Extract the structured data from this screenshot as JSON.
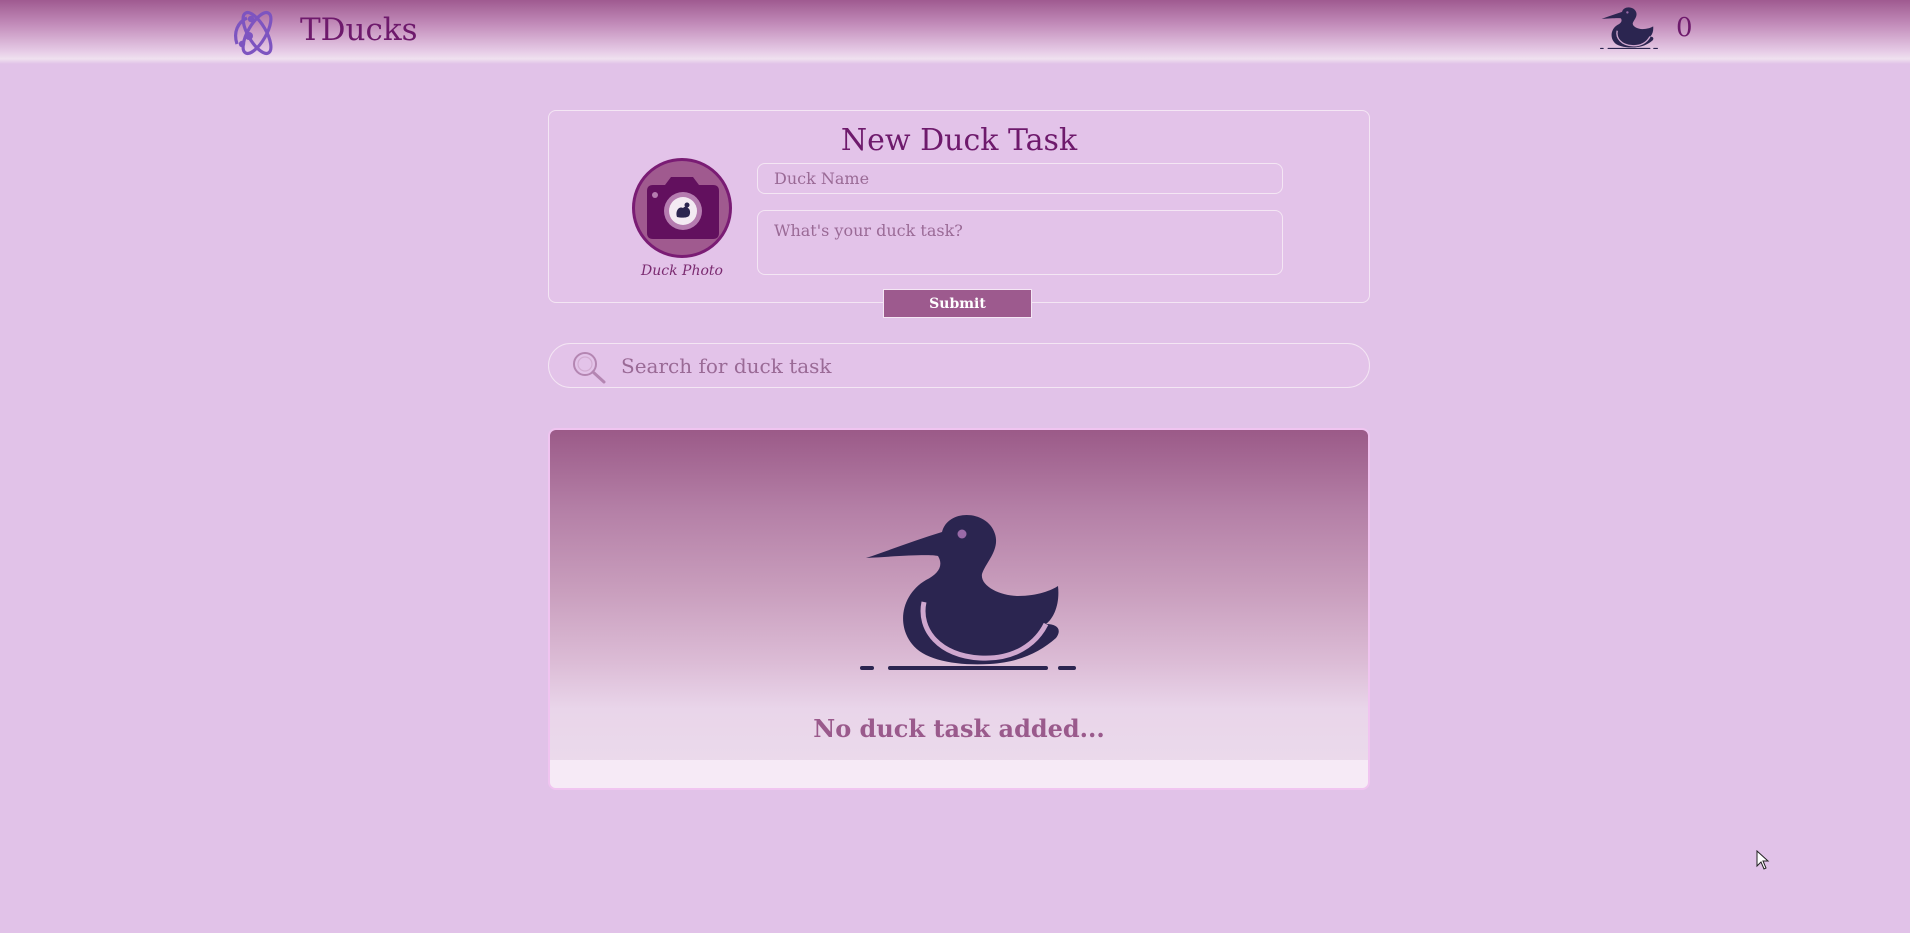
{
  "header": {
    "app_name": "TDucks",
    "logo_icon": "react-logo-icon",
    "counter_icon": "duck-icon",
    "task_count": "0"
  },
  "form": {
    "title": "New Duck Task",
    "photo_label": "Duck Photo",
    "photo_icon": "camera-icon",
    "name_placeholder": "Duck Name",
    "task_placeholder": "What's your duck task?",
    "submit_label": "Submit"
  },
  "search": {
    "placeholder": "Search for duck task",
    "icon": "search-icon"
  },
  "task_list": {
    "empty_message": "No duck task added...",
    "empty_icon": "duck-icon"
  },
  "colors": {
    "background": "#e1c2e8",
    "accent": "#6e1a6c",
    "button": "#9d5a8e",
    "duck": "#2b2550"
  }
}
